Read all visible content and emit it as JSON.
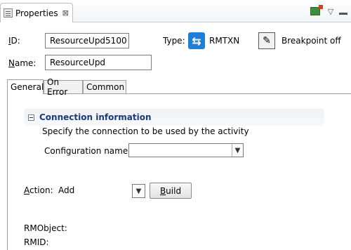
{
  "view": {
    "title": "Properties",
    "close_glyph": "⊠",
    "toolbar": [
      "pin-icon",
      "chevron-down-icon",
      "minimize-icon"
    ]
  },
  "fields": {
    "id_label_access": "I",
    "id_label_rest": "D:",
    "id_value": "ResourceUpd5100",
    "name_label_access": "N",
    "name_label_rest": "ame:",
    "name_value": "ResourceUpd",
    "type_label": "Type:",
    "type_value": "RMTXN",
    "breakpoint_label": "Breakpoint off"
  },
  "tabs": [
    {
      "label": "General",
      "active": true
    },
    {
      "label": "On Error",
      "active": false
    },
    {
      "label": "Common",
      "active": false
    }
  ],
  "connection": {
    "title": "Connection information",
    "description": "Specify the connection to be used by the activity",
    "config_label": "Configuration name:",
    "config_value": ""
  },
  "action": {
    "label_access": "A",
    "label_rest": "ction:",
    "value": "Add",
    "build_access": "B",
    "build_rest": "uild"
  },
  "extra_labels": {
    "rmobject": "RMObject:",
    "rmid": "RMID:"
  },
  "colors": {
    "accent": "#1e7fd6",
    "section_title": "#1a3a7a"
  }
}
